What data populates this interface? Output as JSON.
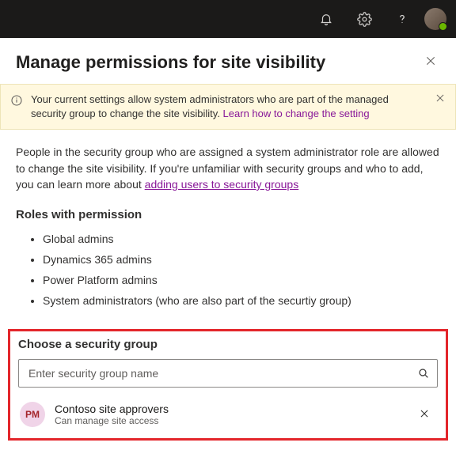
{
  "panel": {
    "title": "Manage permissions for site visibility"
  },
  "banner": {
    "text_before_link": "Your current settings allow system administrators who are part of the managed security group to change the site visibility. ",
    "link_text": "Learn how to change the setting"
  },
  "description": {
    "text_before_link": "People in the security group who are assigned a system administrator role are allowed to change the site visibility. If you're unfamiliar with security groups and who to add, you can learn more about ",
    "link_text": "adding users to security groups"
  },
  "roles": {
    "heading": "Roles with permission",
    "items": [
      "Global admins",
      "Dynamics 365 admins",
      "Power Platform admins",
      "System administrators (who are also part of the securtiy group)"
    ]
  },
  "chooser": {
    "heading": "Choose a security group",
    "placeholder": "Enter security group name",
    "selected": {
      "initials": "PM",
      "name": "Contoso site approvers",
      "sub": "Can manage site access"
    }
  }
}
